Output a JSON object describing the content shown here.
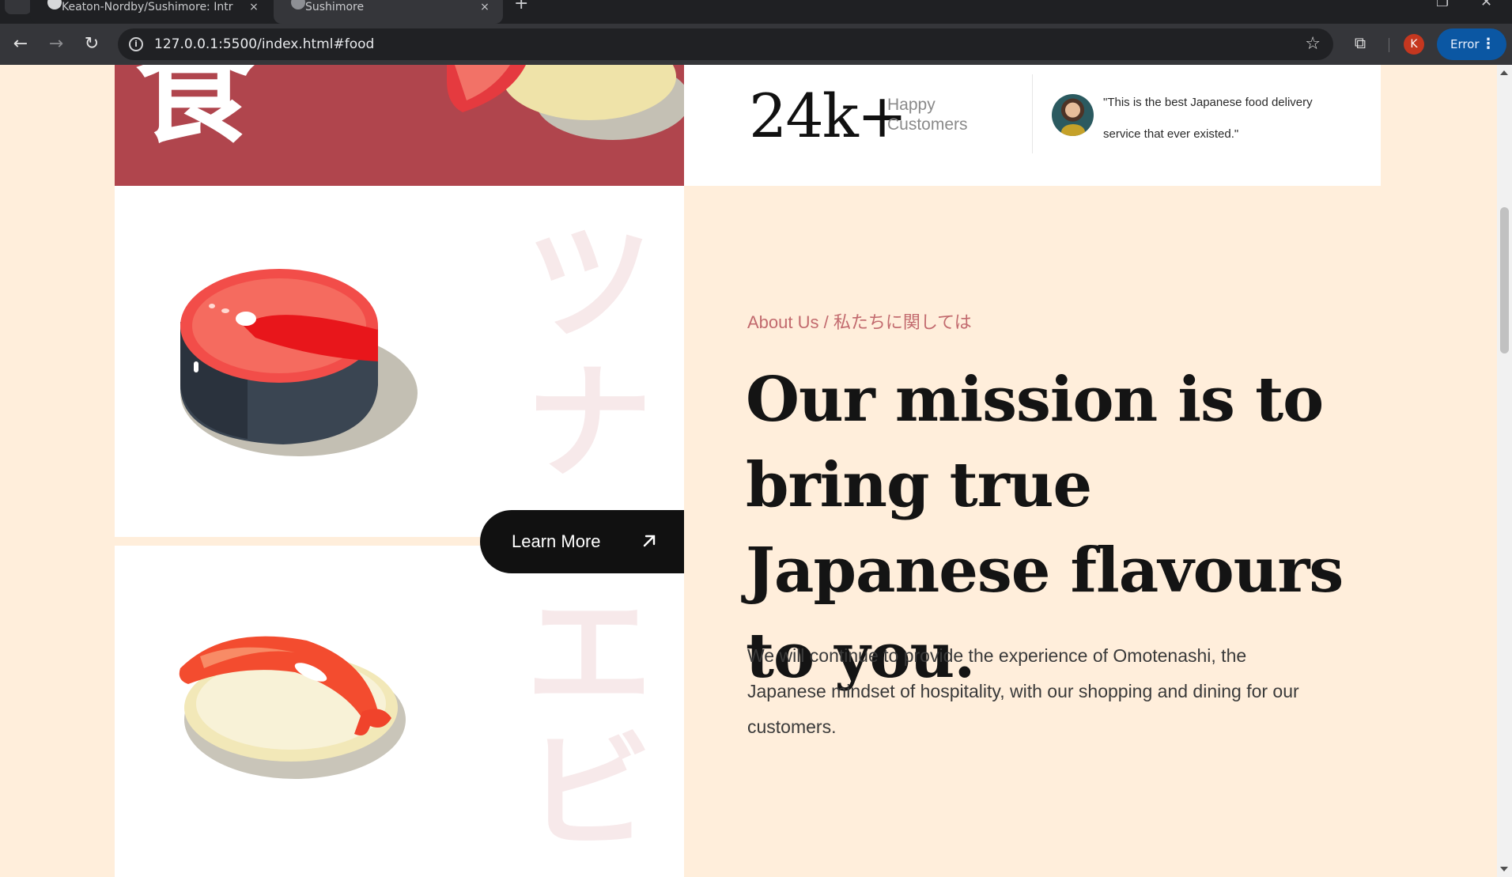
{
  "browser": {
    "tabs": [
      {
        "title": "Keaton-Nordby/Sushimore: Intr",
        "close_glyph": "×"
      },
      {
        "title": "Sushimore",
        "close_glyph": "×"
      }
    ],
    "new_tab_glyph": "+",
    "window_controls": {
      "restore": "❐",
      "close": "✕"
    },
    "nav": {
      "back": "←",
      "forward": "→",
      "reload": "↻"
    },
    "info_glyph": "i",
    "url": "127.0.0.1:5500/index.html#food",
    "bookmark_glyph": "☆",
    "extensions_glyph": "⧉",
    "profile_initial": "K",
    "error_chip": {
      "label": "Error",
      "menu_glyph": "⋮"
    }
  },
  "banner": {
    "kanji": "食"
  },
  "stats": {
    "number": "24k+",
    "label_line1": "Happy",
    "label_line2": "Customers",
    "testimonial": "\"This is the best Japanese food delivery service that ever existed.\""
  },
  "food_cards": [
    {
      "katakana": "ツナ",
      "item": "tuna"
    },
    {
      "katakana": "エビ",
      "item": "ebi"
    }
  ],
  "cta": {
    "label": "Learn More"
  },
  "about": {
    "kicker": "About Us / 私たちに関しては",
    "heading": "Our mission is to bring true Japanese flavours to you.",
    "body": "We will continue to provide the experience of Omotenashi, the Japanese mindset of hospitality, with our shopping and dining for our customers."
  },
  "colors": {
    "page_bg": "#ffeedb",
    "banner_red": "#b0454d",
    "accent_pink": "#c26a6e",
    "button_black": "#111111"
  }
}
